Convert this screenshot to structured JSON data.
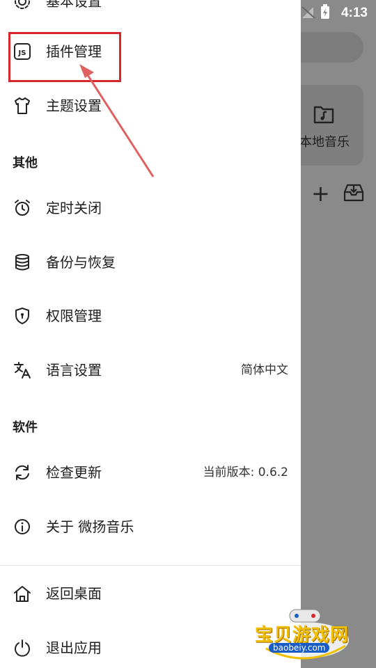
{
  "status": {
    "time": "4:13"
  },
  "background": {
    "card_label": "本地音乐"
  },
  "drawer": {
    "top_partial_label": "基本设置",
    "items_main": [
      {
        "label": "插件管理",
        "icon": "js-plugin-icon"
      },
      {
        "label": "主题设置",
        "icon": "tshirt-icon"
      }
    ],
    "section_other": "其他",
    "items_other": [
      {
        "label": "定时关闭",
        "icon": "alarm-clock-icon"
      },
      {
        "label": "备份与恢复",
        "icon": "database-icon"
      },
      {
        "label": "权限管理",
        "icon": "shield-lock-icon"
      },
      {
        "label": "语言设置",
        "value": "简体中文",
        "icon": "translate-icon"
      }
    ],
    "section_software": "软件",
    "items_software": [
      {
        "label": "检查更新",
        "value": "当前版本: 0.6.2",
        "icon": "refresh-icon"
      },
      {
        "label": "关于 微扬音乐",
        "icon": "info-icon"
      }
    ],
    "items_bottom": [
      {
        "label": "返回桌面",
        "icon": "home-icon"
      },
      {
        "label": "退出应用",
        "icon": "power-icon"
      }
    ]
  },
  "watermark": {
    "text": "宝贝游戏网",
    "url": "baobeiy.com"
  },
  "colors": {
    "highlight": "#d8262a",
    "arrow": "#e06060",
    "scrim": "#8a8a8a"
  }
}
